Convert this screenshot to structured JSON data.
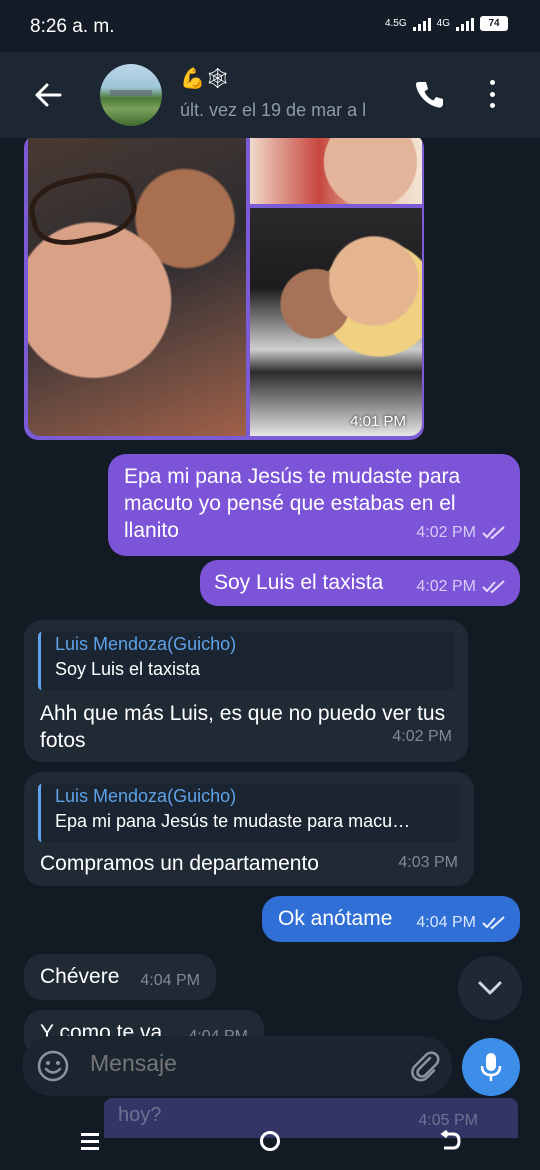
{
  "status_bar": {
    "time": "8:26 a. m.",
    "network_1": "4.5G",
    "network_2": "4G",
    "battery": "74"
  },
  "header": {
    "contact_emoji": "💪🕸",
    "last_seen": "últ. vez el 19 de mar a l"
  },
  "photos": {
    "time": "4:01 PM"
  },
  "messages": [
    {
      "text": "Epa mi pana Jesús te mudaste para macuto yo pensé que estabas en el llanito",
      "time": "4:02 PM",
      "direction": "out"
    },
    {
      "text": "Soy Luis el taxista",
      "time": "4:02 PM",
      "direction": "out"
    },
    {
      "reply_name": "Luis Mendoza(Guicho)",
      "reply_text": "Soy Luis el taxista",
      "text": "Ahh que más Luis, es que no puedo ver tus fotos",
      "time": "4:02 PM",
      "direction": "in"
    },
    {
      "reply_name": "Luis Mendoza(Guicho)",
      "reply_text": "Epa mi pana Jesús te mudaste para macu…",
      "text": "Compramos un departamento",
      "time": "4:03 PM",
      "direction": "in"
    },
    {
      "text": "Ok anótame",
      "time": "4:04 PM",
      "direction": "out"
    },
    {
      "text": "Chévere",
      "time": "4:04 PM",
      "direction": "in"
    },
    {
      "text": "Y como te va",
      "time": "4:04 PM",
      "direction": "in"
    },
    {
      "text": "hoy?",
      "time": "4:05 PM",
      "direction": "out"
    }
  ],
  "input": {
    "placeholder": "Mensaje"
  },
  "colors": {
    "outgoing_bubble": "#7b54d8",
    "outgoing_highlight": "#2f6fd6",
    "incoming_bubble": "#202a35",
    "reply_accent": "#5ea2e8",
    "mic_button": "#3d8ee8",
    "background": "#121a24"
  }
}
